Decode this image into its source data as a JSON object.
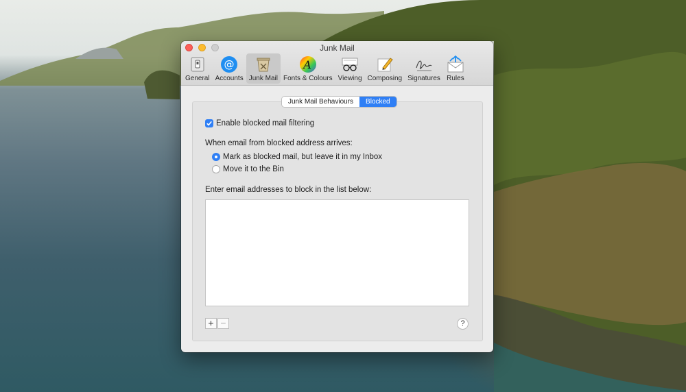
{
  "window": {
    "title": "Junk Mail"
  },
  "toolbar": {
    "items": [
      {
        "label": "General",
        "icon": "general-icon",
        "active": false
      },
      {
        "label": "Accounts",
        "icon": "at-sign-icon",
        "active": false
      },
      {
        "label": "Junk Mail",
        "icon": "junk-mail-icon",
        "active": true
      },
      {
        "label": "Fonts & Colours",
        "icon": "fonts-colours-icon",
        "active": false
      },
      {
        "label": "Viewing",
        "icon": "glasses-icon",
        "active": false
      },
      {
        "label": "Composing",
        "icon": "pencil-icon",
        "active": false
      },
      {
        "label": "Signatures",
        "icon": "signature-icon",
        "active": false
      },
      {
        "label": "Rules",
        "icon": "rules-envelope-icon",
        "active": false
      }
    ]
  },
  "tabs": {
    "items": [
      {
        "label": "Junk Mail Behaviours",
        "selected": false
      },
      {
        "label": "Blocked",
        "selected": true
      }
    ]
  },
  "blocked": {
    "enable_label": "Enable blocked mail filtering",
    "enable_checked": true,
    "when_label": "When email from blocked address arrives:",
    "option_mark": "Mark as blocked mail, but leave it in my Inbox",
    "option_move": "Move it to the Bin",
    "selected_option": "mark",
    "list_label": "Enter email addresses to block in the list below:",
    "add_label": "+",
    "remove_label": "−",
    "help_label": "?"
  },
  "colors": {
    "accent": "#2f7ff5"
  }
}
